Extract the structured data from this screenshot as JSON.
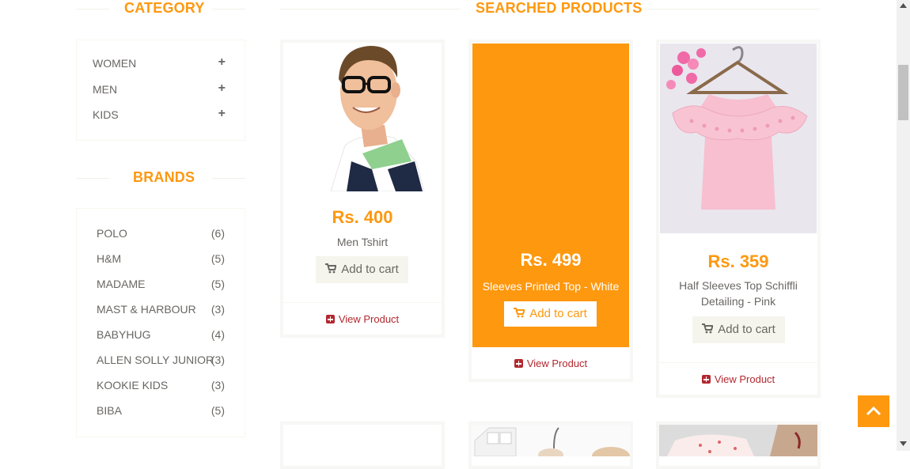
{
  "sidebar": {
    "category_title": "CATEGORY",
    "categories": [
      {
        "label": "WOMEN",
        "toggle": "+"
      },
      {
        "label": "MEN",
        "toggle": "+"
      },
      {
        "label": "KIDS",
        "toggle": "+"
      }
    ],
    "brands_title": "BRANDS",
    "brands": [
      {
        "name": "POLO",
        "count": "(6)"
      },
      {
        "name": "H&M",
        "count": "(5)"
      },
      {
        "name": "MADAME",
        "count": "(5)"
      },
      {
        "name": "MAST & HARBOUR",
        "count": "(3)"
      },
      {
        "name": "BABYHUG",
        "count": "(4)"
      },
      {
        "name": "ALLEN SOLLY JUNIOR",
        "count": "(3)"
      },
      {
        "name": "KOOKIE KIDS",
        "count": "(3)"
      },
      {
        "name": "BIBA",
        "count": "(5)"
      }
    ]
  },
  "main": {
    "title": "SEARCHED PRODUCTS",
    "products": [
      {
        "price": "Rs. 400",
        "name": "Men Tshirt",
        "add_label": "Add to cart",
        "view_label": "View Product",
        "image_icon": "man-tshirt-image"
      },
      {
        "price": "Rs. 499",
        "name": "Sleeves Printed Top - White",
        "add_label": "Add to cart",
        "view_label": "View Product",
        "image_icon": "top-white-image"
      },
      {
        "price": "Rs. 359",
        "name": "Half Sleeves Top Schiffli Detailing - Pink",
        "add_label": "Add to cart",
        "view_label": "View Product",
        "image_icon": "pink-top-image"
      }
    ]
  },
  "colors": {
    "accent": "#fe980f",
    "link": "#b2282f",
    "text": "#696763"
  }
}
